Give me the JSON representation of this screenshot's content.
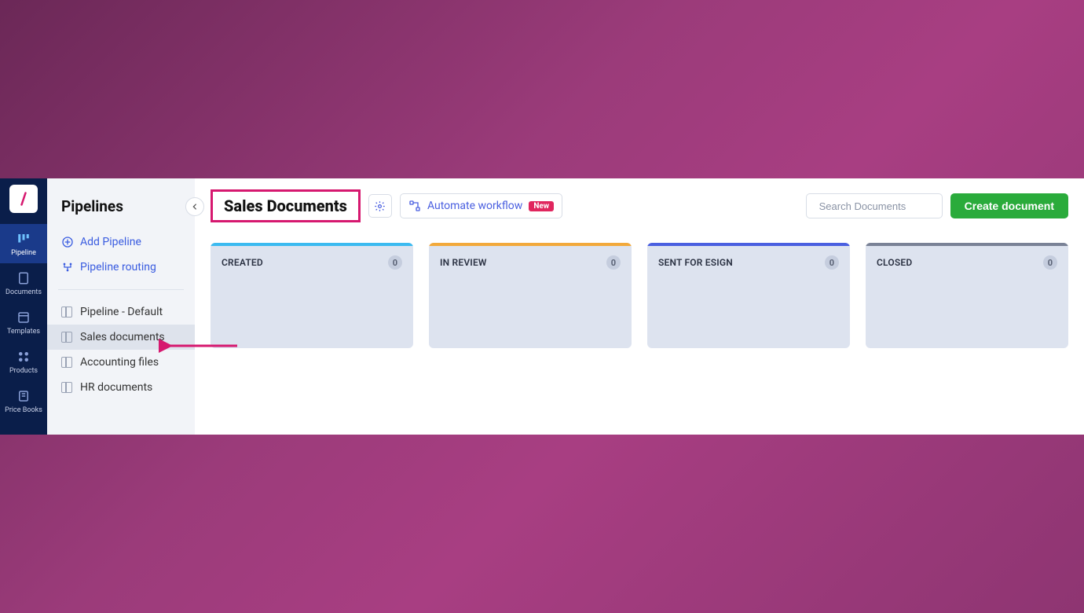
{
  "nav": {
    "items": [
      {
        "label": "Pipeline"
      },
      {
        "label": "Documents"
      },
      {
        "label": "Templates"
      },
      {
        "label": "Products"
      },
      {
        "label": "Price Books"
      }
    ]
  },
  "sidebar": {
    "title": "Pipelines",
    "add_label": "Add Pipeline",
    "routing_label": "Pipeline routing",
    "items": [
      {
        "label": "Pipeline - Default"
      },
      {
        "label": "Sales documents"
      },
      {
        "label": "Accounting files"
      },
      {
        "label": "HR documents"
      }
    ]
  },
  "header": {
    "title": "Sales Documents",
    "automate_label": "Automate workflow",
    "new_badge": "New",
    "search_placeholder": "Search Documents",
    "create_label": "Create document"
  },
  "board": {
    "columns": [
      {
        "name": "CREATED",
        "count": "0",
        "stripe": "#3bbaf0"
      },
      {
        "name": "IN REVIEW",
        "count": "0",
        "stripe": "#f2a93b"
      },
      {
        "name": "SENT FOR ESIGN",
        "count": "0",
        "stripe": "#4a5fe0"
      },
      {
        "name": "CLOSED",
        "count": "0",
        "stripe": "#7a8296"
      }
    ]
  },
  "colors": {
    "highlight": "#d6186f"
  }
}
